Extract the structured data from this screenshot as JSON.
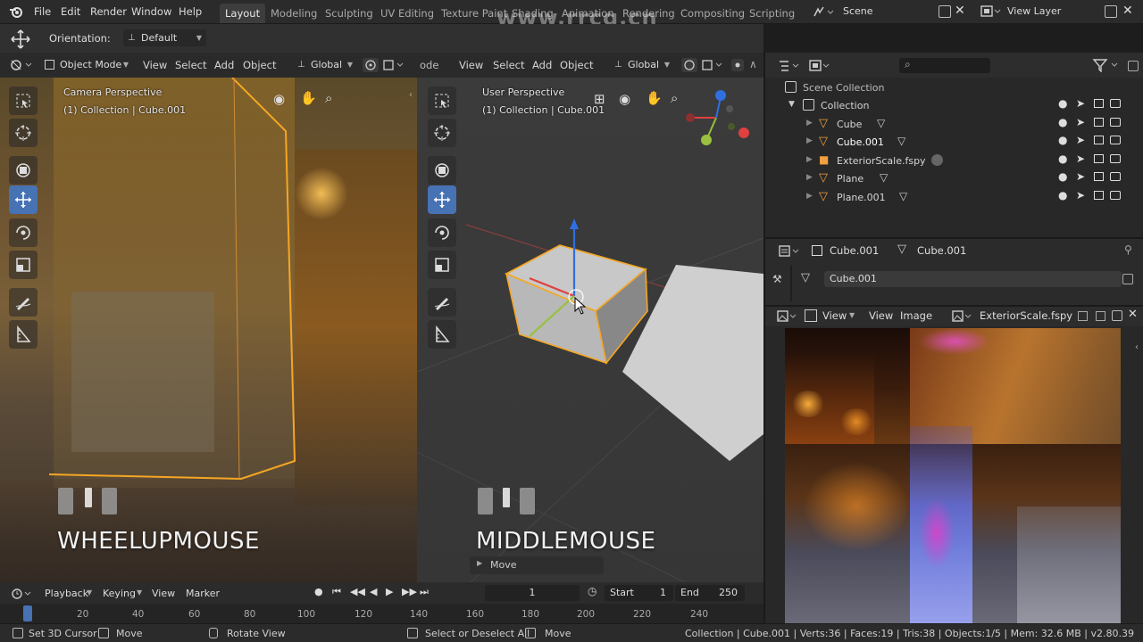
{
  "topbar": {
    "menus": [
      "File",
      "Edit",
      "Render",
      "Window",
      "Help"
    ],
    "workspaces": [
      "Layout",
      "Modeling",
      "Sculpting",
      "UV Editing",
      "Texture Paint",
      "Shading",
      "Animation",
      "Rendering",
      "Compositing",
      "Scripting"
    ],
    "active_workspace": "Layout",
    "scene": "Scene",
    "view_layer": "View Layer",
    "watermark": "www.rrcg.cn"
  },
  "toolsettings": {
    "orientation_label": "Orientation:",
    "orientation_value": "Default"
  },
  "viewport_left": {
    "mode": "Object Mode",
    "menus": [
      "View",
      "Select",
      "Add",
      "Object"
    ],
    "transform": "Global",
    "perspective": "Camera Perspective",
    "collection": "(1) Collection | Cube.001",
    "key_display": "WHEELUPMOUSE"
  },
  "viewport_right": {
    "mode_fragment": "ode",
    "menus": [
      "View",
      "Select",
      "Add",
      "Object"
    ],
    "transform": "Global",
    "perspective": "User Perspective",
    "collection": "(1) Collection | Cube.001",
    "key_display": "MIDDLEMOUSE",
    "operator_panel": "Move"
  },
  "outliner": {
    "scene_collection": "Scene Collection",
    "collection": "Collection",
    "items": [
      {
        "name": "Cube",
        "icon": "mesh-data-icon"
      },
      {
        "name": "Cube.001",
        "icon": "mesh-data-icon"
      },
      {
        "name": "ExteriorScale.fspy",
        "icon": "camera-data-icon"
      },
      {
        "name": "Plane",
        "icon": "mesh-data-icon"
      },
      {
        "name": "Plane.001",
        "icon": "mesh-data-icon"
      }
    ]
  },
  "properties": {
    "object_name": "Cube.001",
    "mesh_name": "Cube.001",
    "data_field": "Cube.001"
  },
  "image_editor": {
    "menus": [
      "View",
      "View",
      "Image"
    ],
    "image_name": "ExteriorScale.fspy"
  },
  "timeline": {
    "menus": [
      "Playback",
      "Keying",
      "View",
      "Marker"
    ],
    "current_frame": "1",
    "start_label": "Start",
    "start_value": "1",
    "end_label": "End",
    "end_value": "250",
    "ticks": [
      "20",
      "40",
      "60",
      "80",
      "100",
      "120",
      "140",
      "160",
      "180",
      "200",
      "220",
      "240"
    ]
  },
  "statusbar": {
    "left": [
      "Set 3D Cursor",
      "Move",
      "Rotate View",
      "Select or Deselect All",
      "Move"
    ],
    "stats": "Collection | Cube.001 | Verts:36 | Faces:19 | Tris:38 | Objects:1/5 | Mem: 32.6 MB | v2.80.39"
  },
  "colors": {
    "accent": "#4772b3",
    "selection_orange": "#f5a623",
    "bg_panel": "#2b2b2b"
  }
}
